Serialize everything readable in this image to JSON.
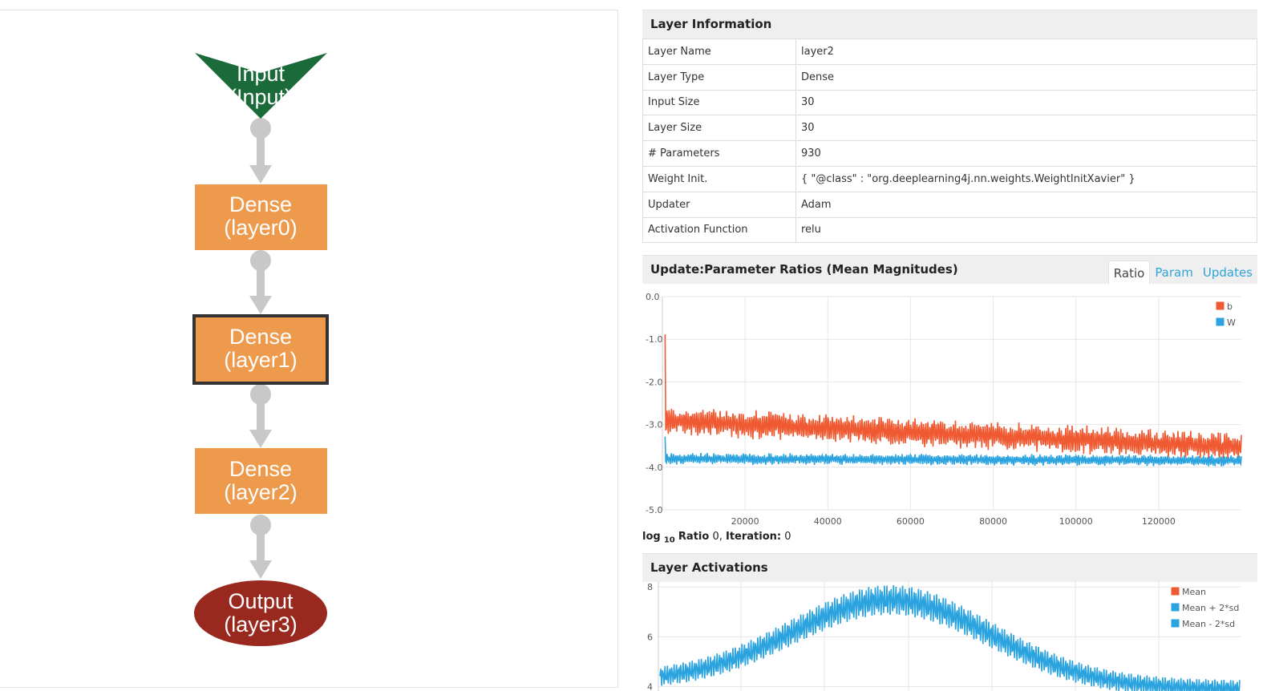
{
  "graph": {
    "nodes": [
      {
        "name": "Input",
        "sub": "(Input)",
        "shape": "arrowhead",
        "color": "#1b6b3a"
      },
      {
        "name": "Dense",
        "sub": "(layer0)",
        "shape": "box",
        "color": "#ee9a4d"
      },
      {
        "name": "Dense",
        "sub": "(layer1)",
        "shape": "box-selected",
        "color": "#ee9a4d"
      },
      {
        "name": "Dense",
        "sub": "(layer2)",
        "shape": "box",
        "color": "#ee9a4d"
      },
      {
        "name": "Output",
        "sub": "(layer3)",
        "shape": "ellipse",
        "color": "#99281f"
      }
    ],
    "edge_color": "#c8c8c8",
    "selected_border": "#333333"
  },
  "layer_info": {
    "title": "Layer Information",
    "rows": [
      {
        "key": "Layer Name",
        "value": "layer2"
      },
      {
        "key": "Layer Type",
        "value": "Dense"
      },
      {
        "key": "Input Size",
        "value": "30"
      },
      {
        "key": "Layer Size",
        "value": "30"
      },
      {
        "key": "# Parameters",
        "value": "930"
      },
      {
        "key": "Weight Init.",
        "value": "{ \"@class\" : \"org.deeplearning4j.nn.weights.WeightInitXavier\" }"
      },
      {
        "key": "Updater",
        "value": "Adam"
      },
      {
        "key": "Activation Function",
        "value": "relu"
      }
    ]
  },
  "ratio_section": {
    "title": "Update:Parameter Ratios (Mean Magnitudes)",
    "tabs": [
      {
        "label": "Ratio",
        "active": true
      },
      {
        "label": "Param",
        "active": false
      },
      {
        "label": "Updates",
        "active": false
      }
    ],
    "footer_log": "log",
    "footer_sub": "10",
    "footer_ratio_label": "Ratio",
    "footer_ratio_value": "0",
    "footer_iter_label": "Iteration:",
    "footer_iter_value": "0"
  },
  "activations_section": {
    "title": "Layer Activations"
  },
  "chart_data": [
    {
      "type": "line",
      "ylim": [
        -5.0,
        0.0
      ],
      "xlim": [
        0,
        140000
      ],
      "yticks": [
        "0.0",
        "-1.0",
        "-2.0",
        "-3.0",
        "-4.0",
        "-5.0"
      ],
      "xticks": [
        "20000",
        "40000",
        "60000",
        "80000",
        "100000",
        "120000"
      ],
      "grid": true,
      "legend": "top-right",
      "series": [
        {
          "name": "b",
          "color": "#f05a32",
          "start": -0.9,
          "plateau_start": -2.9,
          "plateau_end": -3.6,
          "amplitude": 0.25
        },
        {
          "name": "W",
          "color": "#2aa3df",
          "start": -3.3,
          "plateau_start": -3.8,
          "plateau_end": -3.85,
          "amplitude": 0.1
        }
      ]
    },
    {
      "type": "line",
      "ylim": [
        3.5,
        8.2
      ],
      "yticks": [
        "8",
        "6",
        "4"
      ],
      "grid": true,
      "legend": "top-right",
      "series": [
        {
          "name": "Mean",
          "color": "#f05a32"
        },
        {
          "name": "Mean + 2*sd",
          "color": "#2aa3df"
        },
        {
          "name": "Mean - 2*sd",
          "color": "#2aa3df"
        }
      ]
    }
  ]
}
